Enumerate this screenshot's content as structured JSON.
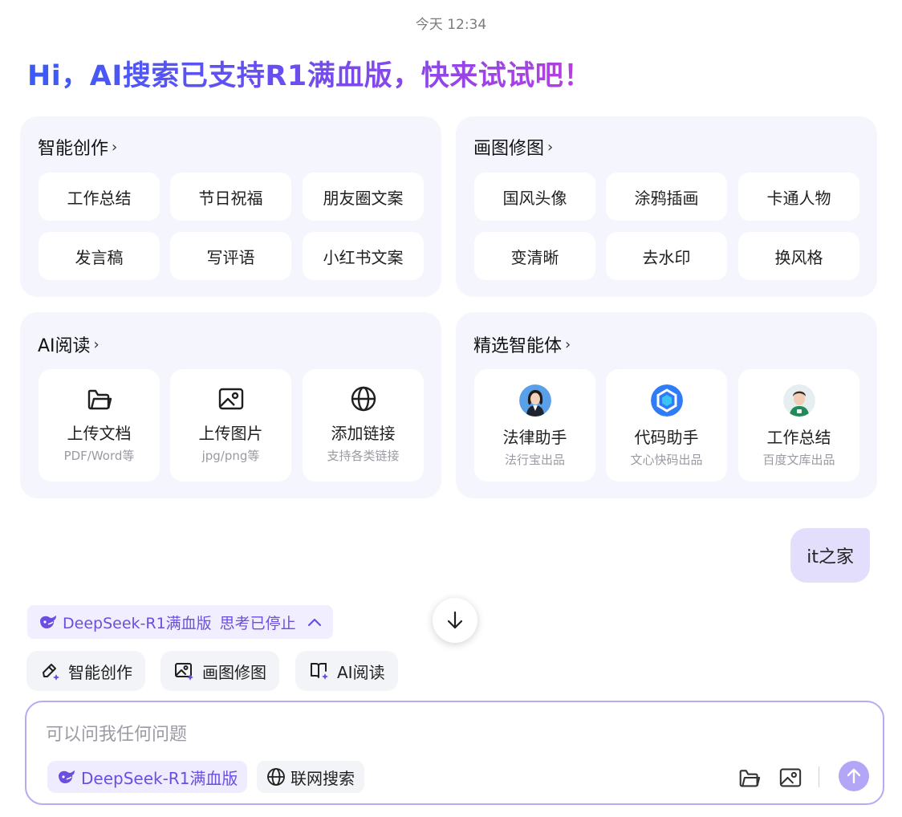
{
  "timestamp": "今天 12:34",
  "greeting": "Hi，AI搜索已支持R1满血版，快来试试吧！",
  "cards": {
    "creation": {
      "title": "智能创作",
      "items": [
        "工作总结",
        "节日祝福",
        "朋友圈文案",
        "发言稿",
        "写评语",
        "小红书文案"
      ]
    },
    "image": {
      "title": "画图修图",
      "items": [
        "国风头像",
        "涂鸦插画",
        "卡通人物",
        "变清晰",
        "去水印",
        "换风格"
      ]
    },
    "reading": {
      "title": "AI阅读",
      "tiles": [
        {
          "name": "上传文档",
          "sub": "PDF/Word等",
          "icon": "folder-icon"
        },
        {
          "name": "上传图片",
          "sub": "jpg/png等",
          "icon": "image-icon"
        },
        {
          "name": "添加链接",
          "sub": "支持各类链接",
          "icon": "globe-icon"
        }
      ]
    },
    "agents": {
      "title": "精选智能体",
      "tiles": [
        {
          "name": "法律助手",
          "sub": "法行宝出品",
          "icon": "lawyer-avatar"
        },
        {
          "name": "代码助手",
          "sub": "文心快码出品",
          "icon": "code-logo"
        },
        {
          "name": "工作总结",
          "sub": "百度文库出品",
          "icon": "worker-avatar"
        }
      ]
    }
  },
  "chevron": "›",
  "user_message": "it之家",
  "model_status": {
    "model": "DeepSeek-R1满血版",
    "status": "思考已停止",
    "icon": "whale-icon"
  },
  "quick_actions": [
    {
      "label": "智能创作",
      "icon": "pen-sparkle-icon"
    },
    {
      "label": "画图修图",
      "icon": "image-sparkle-icon"
    },
    {
      "label": "AI阅读",
      "icon": "book-sparkle-icon"
    }
  ],
  "composer": {
    "placeholder": "可以问我任何问题",
    "model_chip": "DeepSeek-R1满血版",
    "web_chip": "联网搜索"
  },
  "colors": {
    "accent": "#6b4ee0",
    "send": "#b4a6f6",
    "card_bg": "#f5f6fd",
    "bubble": "#e3defc"
  }
}
